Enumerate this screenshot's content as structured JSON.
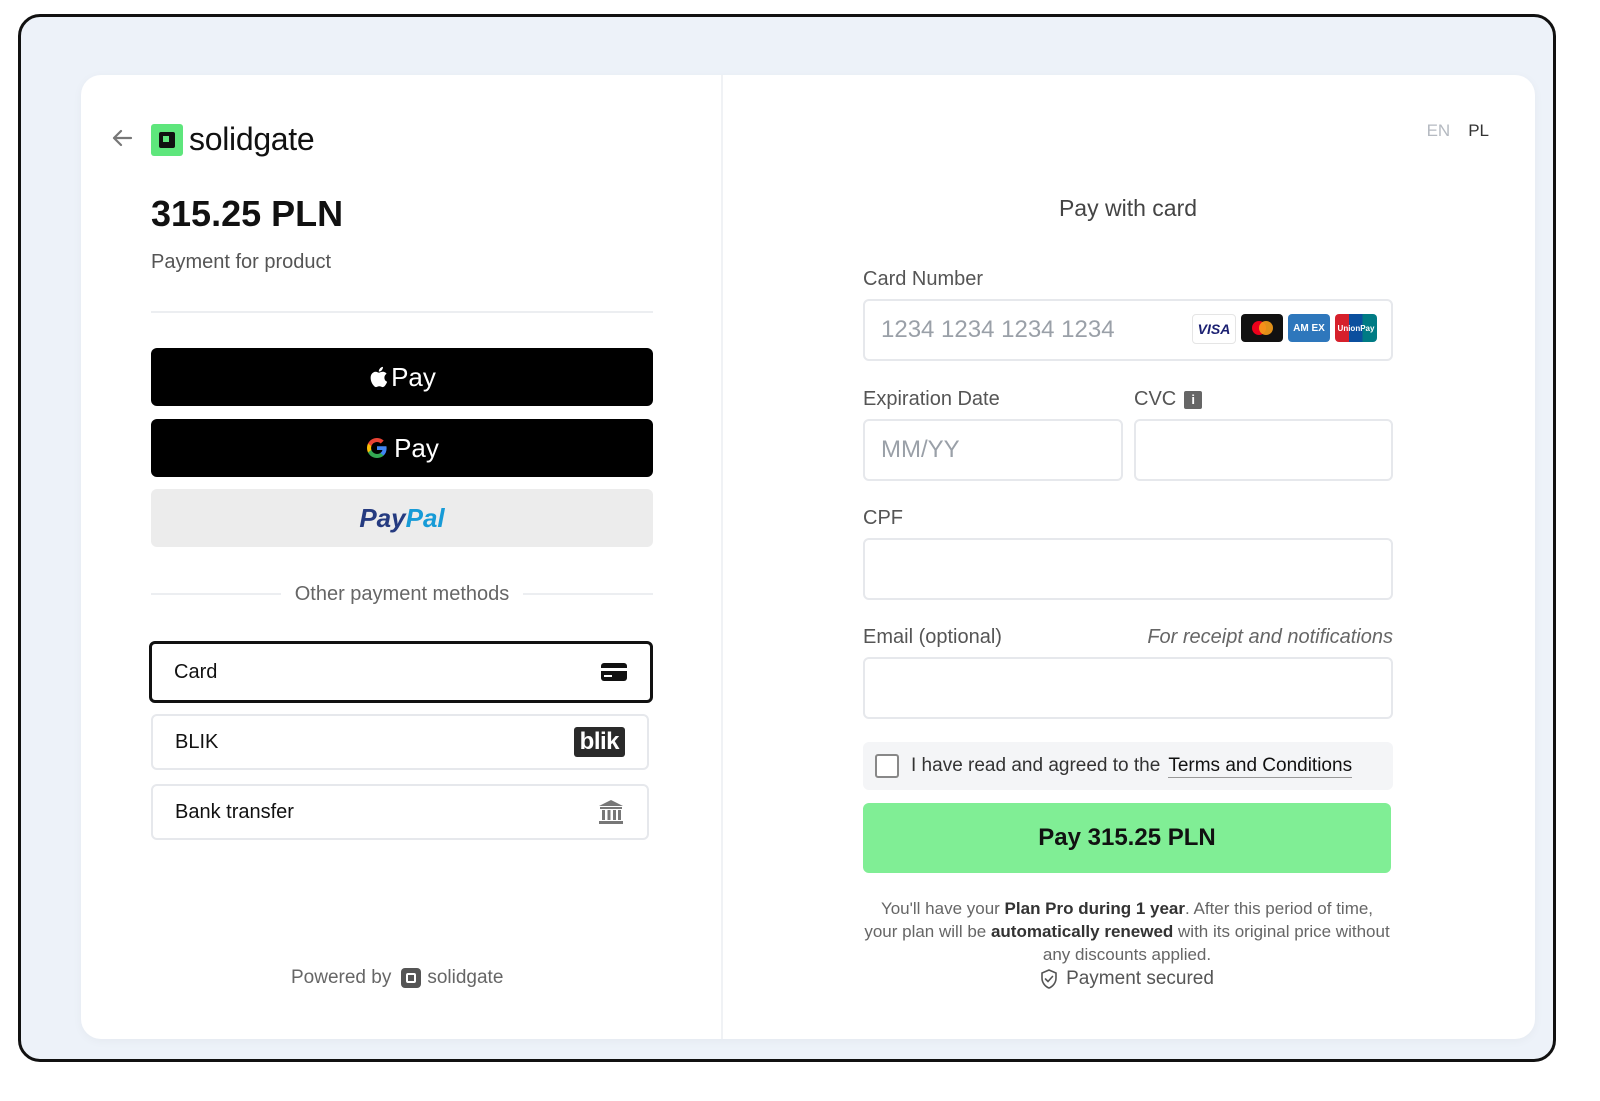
{
  "brand": {
    "name": "solidgate"
  },
  "order": {
    "amount": "315.25 PLN",
    "description": "Payment for product"
  },
  "wallets": {
    "apple_pay": "Pay",
    "google_pay": "Pay",
    "paypal_part1": "Pay",
    "paypal_part2": "Pal"
  },
  "other_methods_label": "Other payment methods",
  "methods": [
    {
      "label": "Card",
      "icon": "credit-card-icon"
    },
    {
      "label": "BLIK",
      "icon": "blik-logo",
      "badge": "blik"
    },
    {
      "label": "Bank transfer",
      "icon": "bank-icon"
    }
  ],
  "powered": {
    "label": "Powered by",
    "brand": "solidgate"
  },
  "languages": [
    "EN",
    "PL"
  ],
  "form": {
    "title": "Pay with card",
    "card_number_label": "Card Number",
    "card_number_placeholder": "1234 1234 1234 1234",
    "card_brands": [
      "VISA",
      "Mastercard",
      "AMEX",
      "UnionPay"
    ],
    "card_brand_text": {
      "visa": "VISA",
      "amex": "AM EX",
      "unionpay": "UnionPay"
    },
    "expiry_label": "Expiration Date",
    "expiry_placeholder": "MM/YY",
    "cvc_label": "CVC",
    "cvc_info_icon": "i",
    "cpf_label": "CPF",
    "email_label": "Email (optional)",
    "email_hint": "For receipt and notifications",
    "terms_text": "I have read and agreed to the",
    "terms_link": "Terms and Conditions",
    "pay_button": "Pay 315.25 PLN",
    "note_1": "You'll have your ",
    "note_b1": "Plan Pro during 1 year",
    "note_2": ". After this period of time, your plan will be ",
    "note_b2": "automatically renewed",
    "note_3": " with its original price without any discounts applied.",
    "secured": "Payment secured"
  },
  "colors": {
    "accent": "#80ee95",
    "logo_green": "#5ee67c",
    "background": "#edf2f9"
  }
}
